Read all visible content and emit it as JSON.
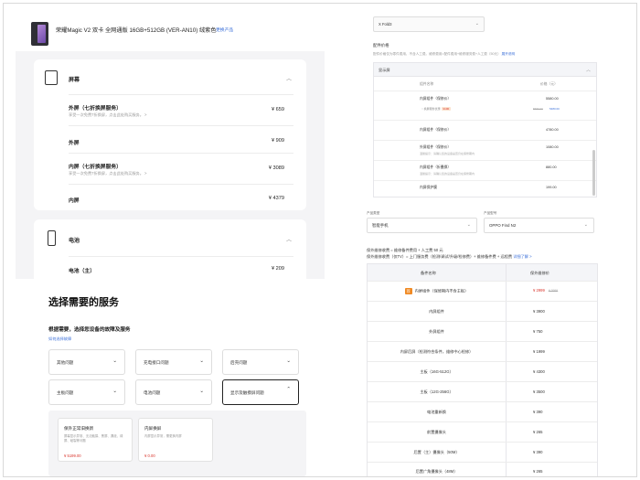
{
  "panel_a": {
    "product_title": "荣耀Magic V2 双卡 全网通版 16GB+512GB (VER-AN10) 绒紫色",
    "change_link": "更换产品",
    "screen_card": {
      "heading": "屏幕",
      "rows": [
        {
          "name": "外屏（七折换屏服务）",
          "sub": "享受一次免费7折换屏，点击此处购买服务。  >",
          "price": "¥ 659"
        },
        {
          "name": "外屏",
          "sub": "",
          "price": "¥ 909"
        },
        {
          "name": "内屏（七折换屏服务）",
          "sub": "享受一次免费7折换屏，点击此处购买服务。  >",
          "price": "¥ 3089"
        },
        {
          "name": "内屏",
          "sub": "",
          "price": "¥ 4379"
        }
      ]
    },
    "battery_card": {
      "heading": "电池",
      "rows": [
        {
          "name": "电池（主）",
          "price": "¥ 209"
        }
      ]
    }
  },
  "panel_b": {
    "title": "选择需要的服务",
    "subtitle": "根据需要，选择您设备的故障及服务",
    "help_link": "如何选择故障",
    "categories": [
      "其他问题",
      "充电接口问题",
      "后壳问题",
      "主板问题",
      "电池问题",
      "显示及触摸屏问题"
    ],
    "services": [
      {
        "title": "保外正常旧换新",
        "desc": "屏幕显示异常、无法触摸、黑屏、漏液、绿屏、破裂等问题",
        "price": "¥ 5199.00"
      },
      {
        "title": "内屏换屏",
        "desc": "内屏显示异常，需更换内屏",
        "price": "¥ 0.00"
      }
    ]
  },
  "panel_c": {
    "model_select": "X Fold3",
    "price_heading": "配件价格",
    "note_text": "配件价格仅为零件费用，不含人工费。维修费用=配件费用+维修服务费+人工费（50元）",
    "note_link": "展开说明",
    "section": "显示屏",
    "col_name": "组件名称",
    "col_price": "价格（元）",
    "rows": [
      {
        "name": "内屏组件（保修价）",
        "note": "",
        "price": "5580.00"
      },
      {
        "name": "内屏组件（保修价）",
        "note": "",
        "price": "4780.00"
      },
      {
        "name": "外屏组件（保修价）",
        "note": "温馨提示：请确认您的设备是否仍在保修期内",
        "price": "1080.00"
      },
      {
        "name": "内屏组件（折叠换）",
        "note": "温馨提示：请确认您的设备是否仍在保修期内",
        "price": "880.00"
      },
      {
        "name": "内屏保护膜",
        "note": "",
        "price": "199.00"
      }
    ],
    "option": {
      "label": "换屏服务优惠",
      "tag": "¥100",
      "old": "5580.00",
      "new": "5480.00"
    }
  },
  "panel_d": {
    "label_type": "产品类型",
    "label_model": "产品型号",
    "type_value": "智能手机",
    "model_value": "OPPO Find N2",
    "formula1": "保外维修收费 = 维修备件费用 + 人工费 50 元",
    "formula2": "保外维修收费（仅TV）= 上门服务费（检测/调试/升级/检修费）+ 维修备件费 + 远程费",
    "formula_link": "详细了解 >",
    "col_part": "备件名称",
    "col_price": "保外维修价",
    "rows": [
      {
        "name": "内屏组件（保修期内不含主板）",
        "price": "¥ 2999",
        "old": "¥ 3999",
        "badge": "荐"
      },
      {
        "name": "内屏组件",
        "price": "¥ 3900"
      },
      {
        "name": "外屏组件",
        "price": "¥ 750"
      },
      {
        "name": "内屏后屏（检测符合条件，维修中心检修）",
        "price": "¥ 1999"
      },
      {
        "name": "主板（16G-512G）",
        "price": "¥ 4300"
      },
      {
        "name": "主板（12G-256G）",
        "price": "¥ 3500"
      },
      {
        "name": "电池重新换",
        "price": "¥ 390"
      },
      {
        "name": "前置摄像头",
        "price": "¥ 265"
      },
      {
        "name": "后置（主）摄像头（50M）",
        "price": "¥ 390"
      },
      {
        "name": "后置广角摄像头（48M）",
        "price": "¥ 265"
      }
    ]
  }
}
